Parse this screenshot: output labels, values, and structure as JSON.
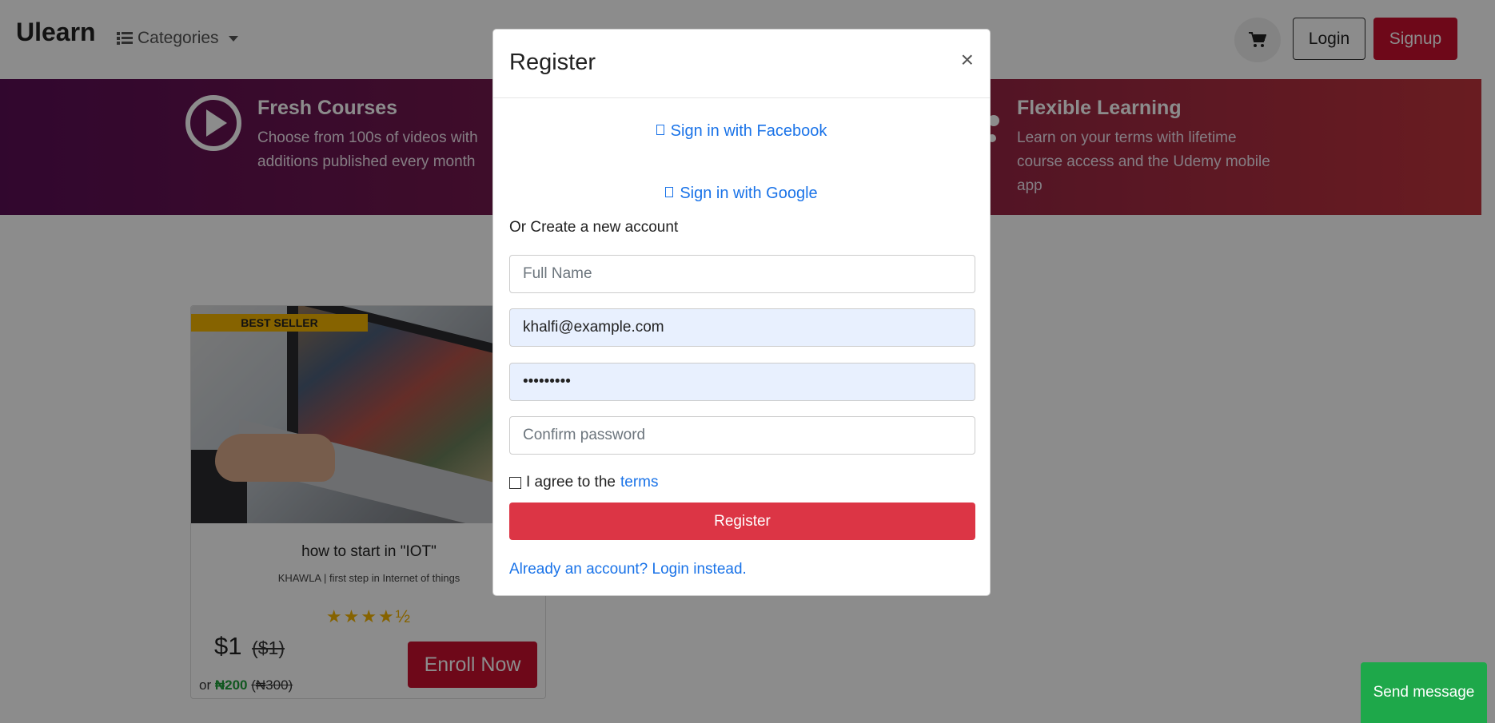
{
  "navbar": {
    "brand": "Ulearn",
    "categories_label": "Categories",
    "login_label": "Login",
    "signup_label": "Signup"
  },
  "banner": {
    "features": [
      {
        "title": "Fresh Courses",
        "line1": "Choose from 100s of videos with",
        "line2": "additions published every month"
      },
      {
        "title": "Flexible Learning",
        "line1": "Learn on your terms with lifetime",
        "line2": "course access and the Udemy mobile",
        "line3": "app"
      }
    ]
  },
  "course": {
    "badge": "BEST SELLER",
    "title": "how to start in \"IOT\"",
    "subtitle": "KHAWLA | first step in Internet of things",
    "rating": 4.5,
    "stars": "★★★★½",
    "price": "$1",
    "price_old": "($1)",
    "ngn_prefix": "or",
    "ngn_price": "₦200",
    "ngn_price_old": "(₦300)",
    "enroll_label": "Enroll Now"
  },
  "modal": {
    "title": "Register",
    "close": "×",
    "facebook_label": "Sign in with Facebook",
    "google_label": "Sign in with Google",
    "or_text": "Or Create a new account",
    "fields": {
      "full_name_placeholder": "Full Name",
      "email_value": "khalfi@example.com",
      "password_value": "•••••••••",
      "confirm_placeholder": "Confirm password"
    },
    "terms_prefix": "I agree to the",
    "terms_link": "terms",
    "register_label": "Register",
    "login_instead": "Already an account? Login instead."
  },
  "send_message_label": "Send message",
  "colors": {
    "brand_red": "#c8102e",
    "register_red": "#dc3545",
    "link_blue": "#1a73e8",
    "send_green": "#1ea84a",
    "badge_yellow": "#f5b400"
  }
}
